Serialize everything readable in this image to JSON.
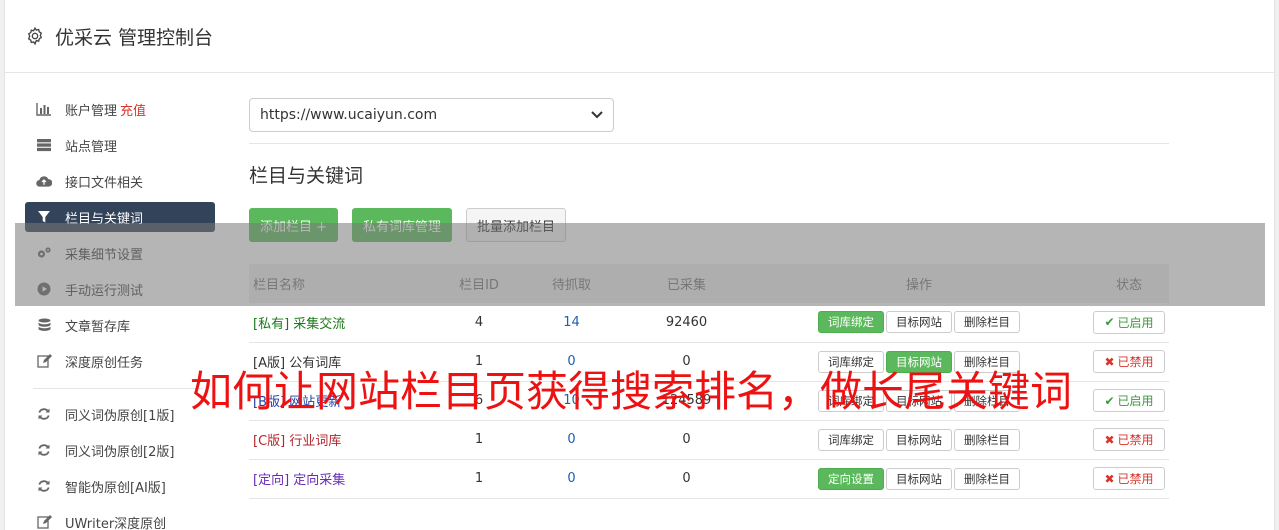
{
  "header": {
    "title": "优采云 管理控制台"
  },
  "sidebar": {
    "items": [
      {
        "label": "账户管理",
        "extra": "充值",
        "icon": "bar-chart-icon"
      },
      {
        "label": "站点管理",
        "icon": "server-icon"
      },
      {
        "label": "接口文件相关",
        "icon": "cloud-upload-icon"
      },
      {
        "label": "栏目与关键词",
        "icon": "filter-icon",
        "active": true
      },
      {
        "label": "采集细节设置",
        "icon": "gears-icon"
      },
      {
        "label": "手动运行测试",
        "icon": "play-icon"
      },
      {
        "label": "文章暂存库",
        "icon": "database-icon"
      },
      {
        "label": "深度原创任务",
        "icon": "edit-icon"
      }
    ],
    "items2": [
      {
        "label": "同义词伪原创[1版]",
        "icon": "refresh-icon"
      },
      {
        "label": "同义词伪原创[2版]",
        "icon": "refresh-icon"
      },
      {
        "label": "智能伪原创[AI版]",
        "icon": "refresh-icon"
      },
      {
        "label": "UWriter深度原创",
        "icon": "edit-icon"
      }
    ]
  },
  "main": {
    "site_select": "https://www.ucaiyun.com",
    "section_title": "栏目与关键词",
    "buttons": {
      "add": "添加栏目 +",
      "private": "私有词库管理",
      "batch": "批量添加栏目"
    },
    "table": {
      "headers": [
        "栏目名称",
        "栏目ID",
        "待抓取",
        "已采集",
        "操作",
        "状态"
      ],
      "rows": [
        {
          "tag": "[私有]",
          "name": "采集交流",
          "id": "4",
          "pending": "14",
          "collected": "92460",
          "b1": "词库绑定",
          "b2": "目标网站",
          "b3": "删除栏目",
          "status": "已启用",
          "mark": "✔"
        },
        {
          "tag": "[A版]",
          "name": "公有词库",
          "id": "1",
          "pending": "0",
          "collected": "0",
          "b1": "词库绑定",
          "b2": "目标网站",
          "b3": "删除栏目",
          "status": "已禁用",
          "mark": "✖"
        },
        {
          "tag": "[B版]",
          "name": "网站更新",
          "id": "6",
          "pending": "10",
          "collected": "124589",
          "b1": "词库绑定",
          "b2": "目标网站",
          "b3": "删除栏目",
          "status": "已启用",
          "mark": "✔"
        },
        {
          "tag": "[C版]",
          "name": "行业词库",
          "id": "1",
          "pending": "0",
          "collected": "0",
          "b1": "词库绑定",
          "b2": "目标网站",
          "b3": "删除栏目",
          "status": "已禁用",
          "mark": "✖"
        },
        {
          "tag": "[定向]",
          "name": "定向采集",
          "id": "1",
          "pending": "0",
          "collected": "0",
          "b1": "定向设置",
          "b2": "目标网站",
          "b3": "删除栏目",
          "status": "已禁用",
          "mark": "✖"
        }
      ]
    }
  },
  "overlay": {
    "caption": "如何让网站栏目页获得搜索排名，做长尾关键词"
  },
  "colors": {
    "green": "#5cb85c",
    "nav_active": "#33445a",
    "tag_private": "#1a7a1a",
    "tag_a": "#333333",
    "tag_b": "#1d3fa3",
    "tag_c": "#b3262b",
    "tag_fixed": "#6a2bb5",
    "link_blue": "#1d5fb0",
    "on_mark": "#3c9a3c",
    "off_mark": "#d9342b",
    "caption": "#ee1111"
  }
}
